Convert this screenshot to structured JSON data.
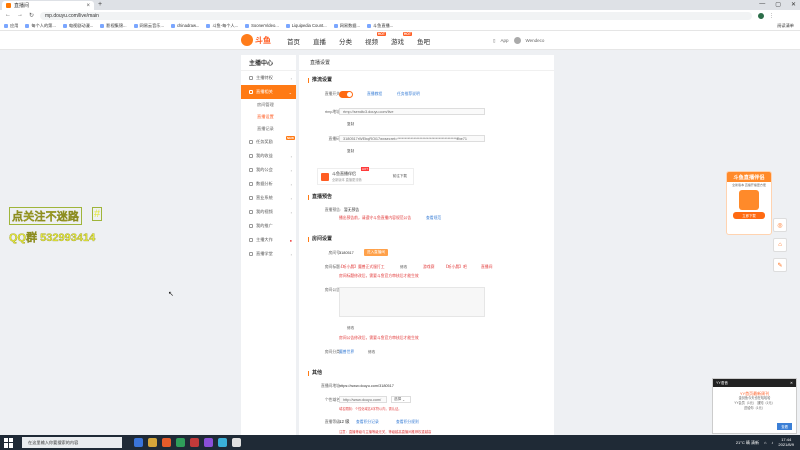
{
  "browser": {
    "tab_title": "直播间",
    "url": "mp.douyu.com/live/main",
    "new_tab": "+",
    "window_controls": [
      "—",
      "▢",
      "✕"
    ],
    "bookmarks": [
      "应用",
      "每个人的第...",
      "电视剧动漫...",
      "影视集锦...",
      "网易云音乐...",
      "chinadraw...",
      "斗鱼-每个人...",
      "SoonerVideo...",
      "Liquipedia Count...",
      "网易数据...",
      "斗鱼直播..."
    ],
    "other_bookmarks": "阅读清单"
  },
  "site": {
    "logo_text": "斗鱼",
    "nav": [
      "首页",
      "直播",
      "分类",
      "视频",
      "游戏",
      "鱼吧"
    ],
    "nav_hot_badge": "HOT",
    "app_label": "App",
    "username": "Wendeco"
  },
  "overlay": {
    "follow_text": "点关注不迷路",
    "tag": "#",
    "qq_text": "QQ群 532993414"
  },
  "sidebar": {
    "title": "主播中心",
    "items": [
      {
        "label": "主播特权",
        "active": false
      },
      {
        "label": "直播相关",
        "active": true
      },
      {
        "label": "房间管理",
        "sub": true
      },
      {
        "label": "直播设置",
        "sub": true,
        "current": true
      },
      {
        "label": "直播记录",
        "sub": true
      },
      {
        "label": "任务奖励",
        "active": false,
        "badge": "NEW"
      },
      {
        "label": "我的收益",
        "active": false
      },
      {
        "label": "我的公会",
        "active": false
      },
      {
        "label": "数据分析",
        "active": false
      },
      {
        "label": "营业系统",
        "active": false
      },
      {
        "label": "我的视频",
        "active": false
      },
      {
        "label": "我的推广",
        "active": false
      },
      {
        "label": "主播大作",
        "active": false,
        "dot": true
      },
      {
        "label": "直播学堂",
        "active": false
      }
    ]
  },
  "main": {
    "breadcrumb": "直播设置",
    "stream": {
      "title": "推流设置",
      "live_switch_label": "直播开关:",
      "switch_link1": "直播教程",
      "switch_link2": "任务推荐说明",
      "rtmp_label": "rtmp地址:",
      "rtmp_value": "rtmp://sendtc3.douyu.com/live",
      "copy1": "复制",
      "code_label": "直播码:",
      "code_value": "3180517rWEbqROi17wxsecret=****************************************ffbe71",
      "copy2": "复制",
      "promo_title": "斗鱼直播伴侣",
      "promo_sub": "全新版本 直播更流畅",
      "promo_hot": "HOT",
      "promo_btn": "前往下载"
    },
    "preview": {
      "title": "直播预告",
      "label": "直播预告:",
      "value": "暂无预告",
      "warn": "播出预告前，请遵守斗鱼直播内容规范公告",
      "link": "查看规范"
    },
    "room": {
      "title": "房间设置",
      "id_label": "房间号:",
      "id_value": "3180517",
      "id_btn": "进入直播间",
      "name_label": "房间标题:",
      "name_value": "【听小晨】魔兽正式服打工",
      "name_edit": "修改",
      "name_tags": [
        "游戏赛",
        "【听小晨】吧",
        "直播间"
      ],
      "name_warn": "房间标题修改后，需要斗鱼官方审核后才能生效",
      "notice_label": "房间公告:",
      "notice_edit": "修改",
      "notice_warn": "房间公告修改后，需要斗鱼官方审核后才能生效",
      "cat_label": "房间分类:",
      "cat_value": "魔兽世界",
      "cat_btn": "修改"
    },
    "other": {
      "title": "其他",
      "url_label": "直播间地址:",
      "url_value": "https://www.douyu.com/3180517",
      "custom_label": "个性域名:",
      "custom_value": "http://www.douyu.com/",
      "custom_select": "选择",
      "custom_warn": "域名限制：个性化域名6字符以内，需认证。",
      "level_label": "直播等级:",
      "level_value": "12 级",
      "level_link1": "查看积分记录",
      "level_link2": "查看积分规则",
      "level_warn": "注意：直播等级与主播等级无关，等级越高直播间推荐权重越高"
    }
  },
  "right_promo": {
    "title": "斗鱼直播伴侣",
    "subtitle": "全新版本 直播开播更方便",
    "btn": "立即下载"
  },
  "float_buttons": [
    "◎",
    "⌂",
    "✎"
  ],
  "popup": {
    "header": "YY语音",
    "close": "✕",
    "title": "YY首页最新周刊",
    "line1": "金剑鱼今天也在哈哈哈",
    "line2": "YY会员（1元） 通知（1元）",
    "line3": "送给你（1元）",
    "btn": "查看"
  },
  "taskbar": {
    "search_placeholder": "在这里输入你要搜索的内容",
    "weather": "21°C 晴 清新",
    "time": "17:44",
    "date": "2021/8/9",
    "app_colors": [
      "#3a74d8",
      "#d6a63a",
      "#e65c2a",
      "#2f9e5a",
      "#c23a3a",
      "#8a4fd8",
      "#3ab0d8",
      "#e0e0e0"
    ]
  }
}
